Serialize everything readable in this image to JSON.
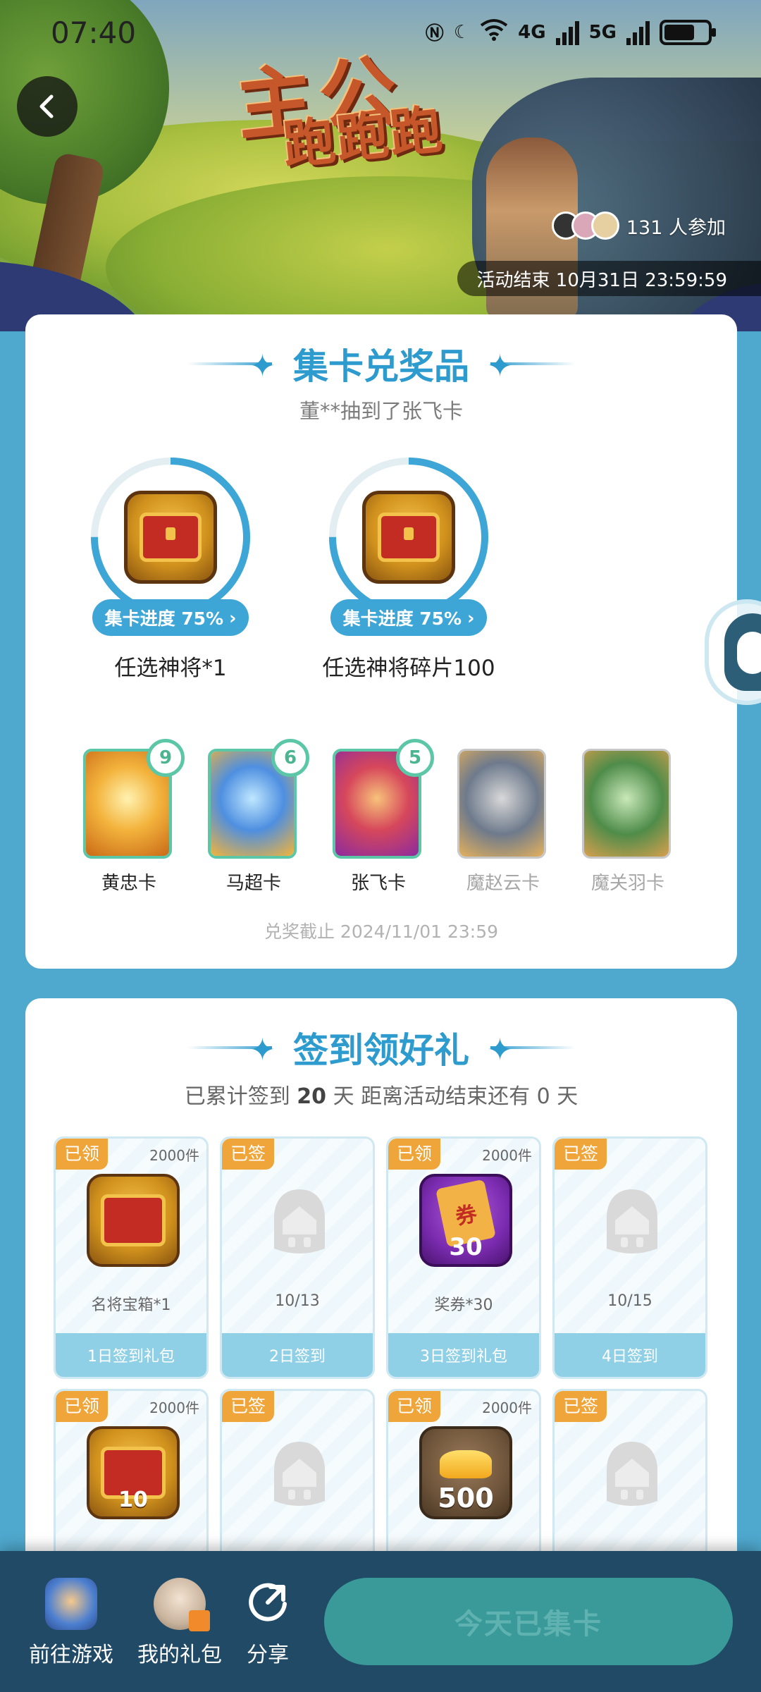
{
  "status_bar": {
    "time": "07:40",
    "net1": "4G",
    "net2": "5G"
  },
  "banner": {
    "title_line1": "主公",
    "title_line2": "跑跑跑",
    "participants": "131 人参加",
    "end_time": "活动结束 10月31日 23:59:59"
  },
  "collect": {
    "title": "集卡兑奖品",
    "broadcast": "董**抽到了张飞卡",
    "prizes": [
      {
        "progress_label": "集卡进度 75%",
        "progress": 0.75,
        "name": "任选神将*1"
      },
      {
        "progress_label": "集卡进度 75%",
        "progress": 0.75,
        "name": "任选神将碎片100"
      }
    ],
    "cards": [
      {
        "name": "黄忠卡",
        "count": "9",
        "owned": true
      },
      {
        "name": "马超卡",
        "count": "6",
        "owned": true
      },
      {
        "name": "张飞卡",
        "count": "5",
        "owned": true
      },
      {
        "name": "魔赵云卡",
        "owned": false
      },
      {
        "name": "魔关羽卡",
        "owned": false
      }
    ],
    "redeem_deadline": "兑奖截止 2024/11/01 23:59"
  },
  "signin": {
    "title": "签到领好礼",
    "note_prefix": "已累计签到",
    "note_days": "20",
    "note_mid": "天   距离活动结束还有 0 天",
    "days": [
      {
        "tag": "已领",
        "stock": "2000件",
        "caption": "名将宝箱*1",
        "footer": "1日签到礼包",
        "kind": "chest"
      },
      {
        "tag": "已签",
        "stock": "",
        "caption": "10/13",
        "footer": "2日签到",
        "kind": "ghost"
      },
      {
        "tag": "已领",
        "stock": "2000件",
        "caption": "奖券*30",
        "footer": "3日签到礼包",
        "kind": "voucher",
        "amount": "30",
        "glyph": "券"
      },
      {
        "tag": "已签",
        "stock": "",
        "caption": "10/15",
        "footer": "4日签到",
        "kind": "ghost"
      },
      {
        "tag": "已领",
        "stock": "2000件",
        "caption": "",
        "footer": "",
        "kind": "chest",
        "amount": "10"
      },
      {
        "tag": "已签",
        "stock": "",
        "caption": "",
        "footer": "",
        "kind": "ghost"
      },
      {
        "tag": "已领",
        "stock": "2000件",
        "caption": "",
        "footer": "",
        "kind": "gold",
        "amount": "500"
      },
      {
        "tag": "已签",
        "stock": "",
        "caption": "",
        "footer": "",
        "kind": "ghost"
      }
    ]
  },
  "bottom_bar": {
    "go_game": "前往游戏",
    "my_gifts": "我的礼包",
    "share": "分享",
    "cta": "今天已集卡"
  },
  "colors": {
    "accent": "#2E9BCE",
    "tag_orange": "#F0A53A",
    "card_border": "#5CC7A6",
    "bg": "#4FA8CE"
  }
}
